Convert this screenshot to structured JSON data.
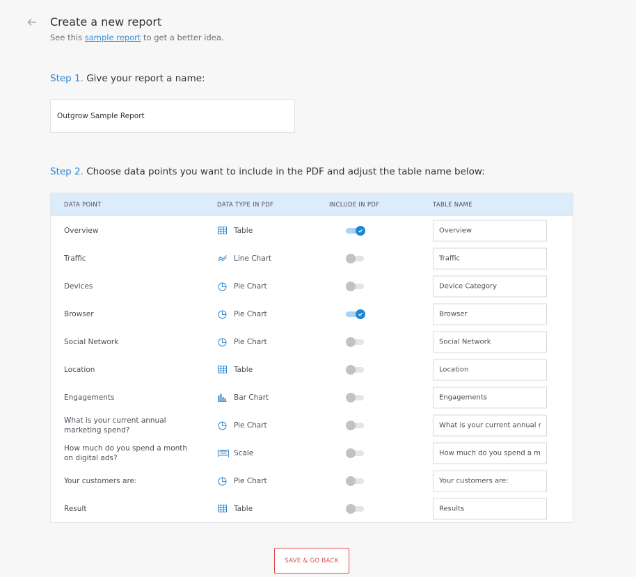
{
  "header": {
    "title": "Create a new report",
    "subtitle_prefix": "See this",
    "subtitle_link": "sample report",
    "subtitle_suffix": "to get a better idea."
  },
  "step1": {
    "label": "Step 1.",
    "text": "Give your report a name:",
    "report_name": "Outgrow Sample Report"
  },
  "step2": {
    "label": "Step 2.",
    "text": "Choose data points you want to include in the PDF and adjust the table name below:"
  },
  "table": {
    "headers": {
      "data_point": "DATA POINT",
      "data_type": "DATA TYPE IN PDF",
      "include": "INCLUDE IN PDF",
      "table_name": "TABLE NAME"
    },
    "rows": [
      {
        "point": "Overview",
        "type": "Table",
        "icon": "table-icon",
        "include": true,
        "name": "Overview"
      },
      {
        "point": "Traffic",
        "type": "Line Chart",
        "icon": "line-chart-icon",
        "include": false,
        "name": "Traffic"
      },
      {
        "point": "Devices",
        "type": "Pie Chart",
        "icon": "pie-chart-icon",
        "include": false,
        "name": "Device Category"
      },
      {
        "point": "Browser",
        "type": "Pie Chart",
        "icon": "pie-chart-icon",
        "include": true,
        "name": "Browser"
      },
      {
        "point": "Social Network",
        "type": "Pie Chart",
        "icon": "pie-chart-icon",
        "include": false,
        "name": "Social Network"
      },
      {
        "point": "Location",
        "type": "Table",
        "icon": "table-icon",
        "include": false,
        "name": "Location"
      },
      {
        "point": "Engagements",
        "type": "Bar Chart",
        "icon": "bar-chart-icon",
        "include": false,
        "name": "Engagements"
      },
      {
        "point": "What is your current annual marketing spend?",
        "type": "Pie Chart",
        "icon": "pie-chart-icon",
        "include": false,
        "name": "What is your current annual ma"
      },
      {
        "point": "How much do you spend a month on digital ads?",
        "type": "Scale",
        "icon": "scale-icon",
        "include": false,
        "name": "How much do you spend a mon"
      },
      {
        "point": "Your customers are:",
        "type": "Pie Chart",
        "icon": "pie-chart-icon",
        "include": false,
        "name": "Your customers are:"
      },
      {
        "point": "Result",
        "type": "Table",
        "icon": "table-icon",
        "include": false,
        "name": "Results"
      }
    ]
  },
  "save_button": "SAVE & GO BACK",
  "colors": {
    "accent": "#2f86d1",
    "toggle_on": "#1f86d3",
    "button": "#e1474d",
    "header_bg": "#dcecfb"
  }
}
